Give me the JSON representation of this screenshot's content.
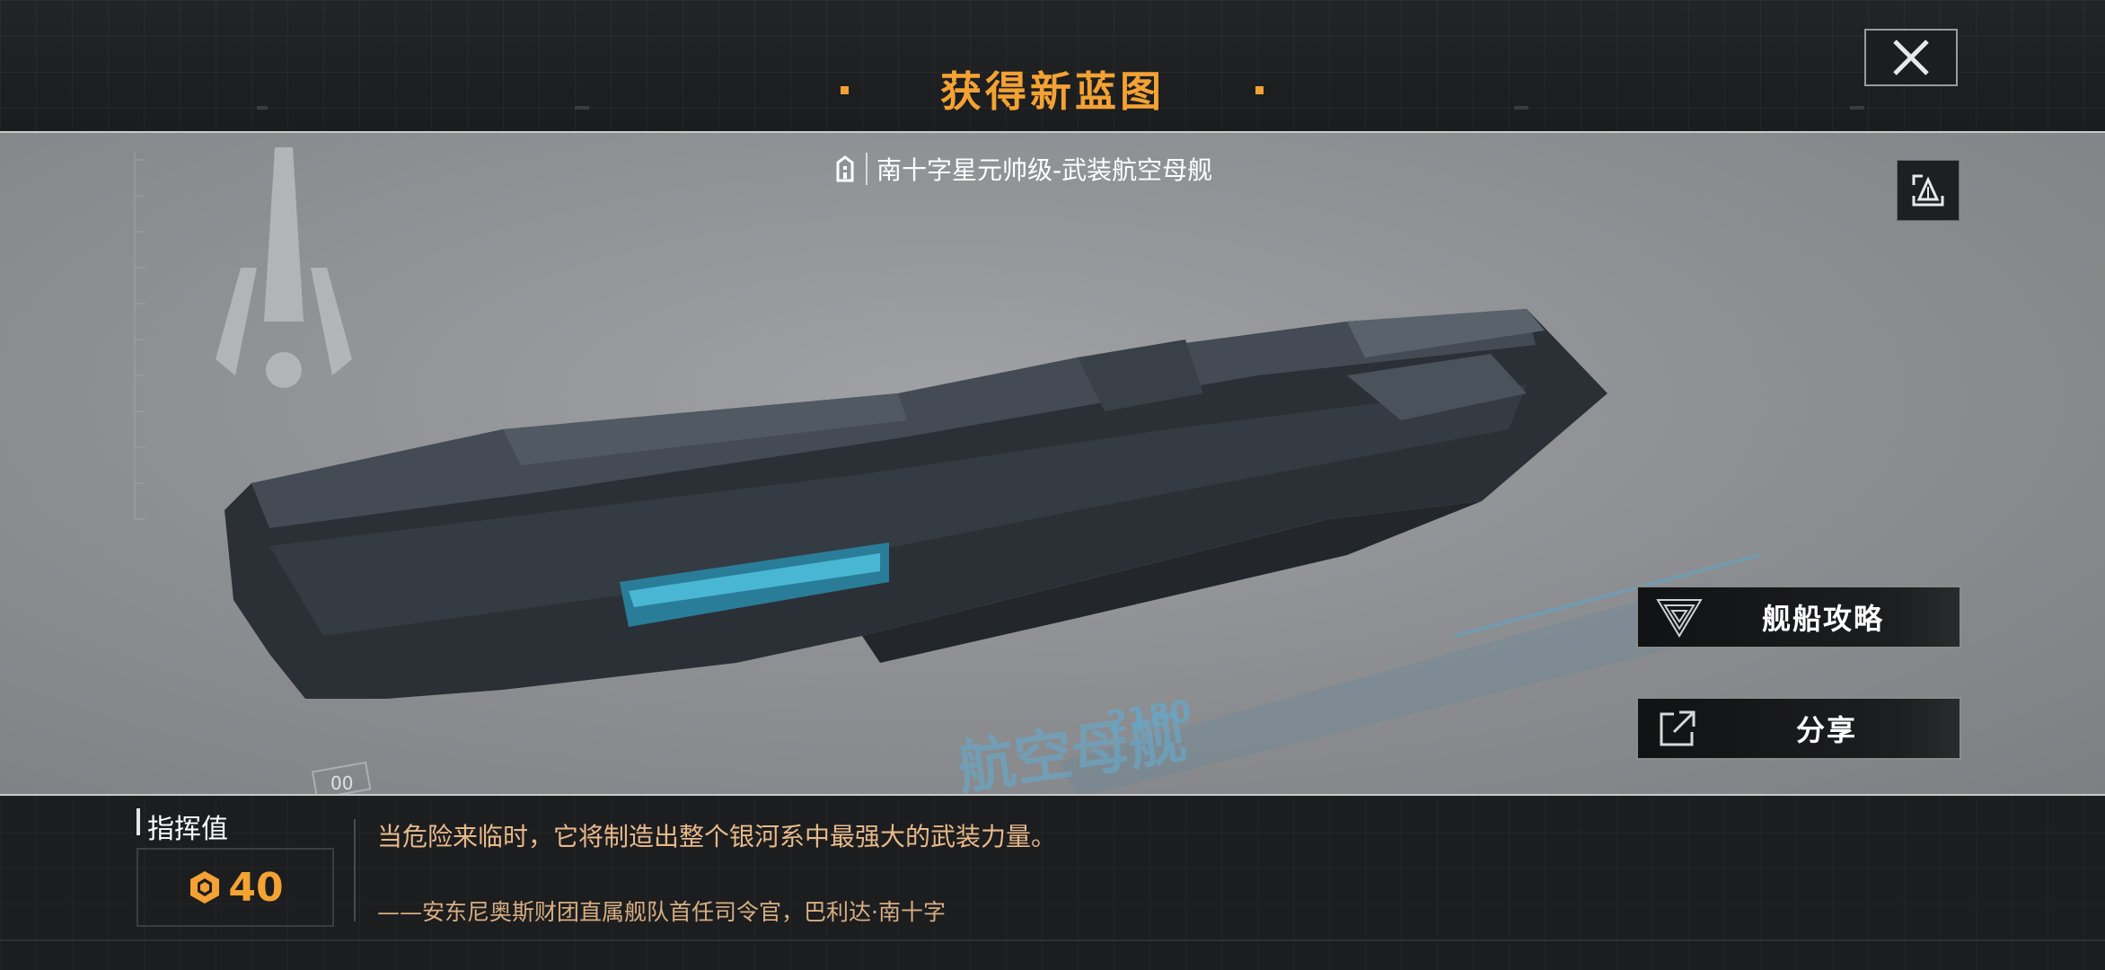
{
  "header": {
    "title": "获得新蓝图",
    "close_icon": "close-icon"
  },
  "ship": {
    "name": "南十字星元帅级-武装航空母舰",
    "class_icon": "ship-class-icon",
    "hull_number": "2180",
    "hull_type_text": "航空母舰",
    "model_counter": "00"
  },
  "actions": {
    "photo_icon": "photo-mode-icon",
    "guide_label": "舰船攻略",
    "share_label": "分享"
  },
  "command": {
    "label": "指挥值",
    "value": "40"
  },
  "description": {
    "quote": "当危险来临时，它将制造出整个银河系中最强大的武装力量。",
    "author": "——安东尼奥斯财团直属舰队首任司令官，巴利达·南十字"
  },
  "colors": {
    "accent": "#f3a233",
    "quote_text": "#e8b98a",
    "viewport_bg": "#8f9194"
  }
}
